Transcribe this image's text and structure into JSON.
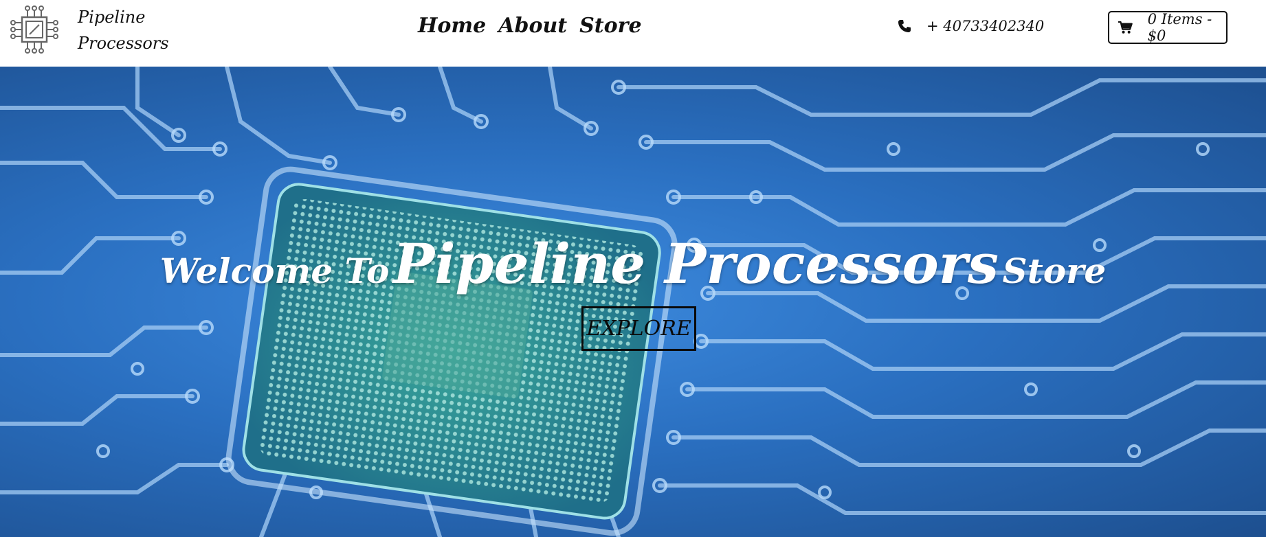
{
  "brand": {
    "name_line1": "Pipeline",
    "name_line2": "Processors",
    "logo_icon": "chip-icon"
  },
  "nav": {
    "links": [
      {
        "label": "Home"
      },
      {
        "label": "About"
      },
      {
        "label": "Store"
      }
    ]
  },
  "contact": {
    "phone_icon": "phone-icon",
    "phone": "+ 40733402340"
  },
  "cart": {
    "icon": "cart-icon",
    "label": "0 Items - $0"
  },
  "hero": {
    "title_prefix": "Welcome To",
    "title_brand": "Pipeline Processors",
    "title_suffix": "Store",
    "cta_label": "EXPLORE",
    "background": "circuit-board-image"
  },
  "colors": {
    "hero_blue": "#2a6fc0",
    "trace_light": "#9ec9f2",
    "chip_green": "#2e8f86"
  }
}
